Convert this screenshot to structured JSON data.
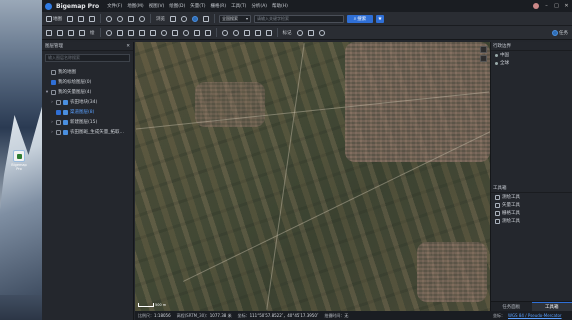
{
  "desktop": {
    "icon_label": "Bigemap\nPro"
  },
  "app": {
    "title": "Bigemap Pro",
    "menu": [
      "文件(F)",
      "地图(M)",
      "视图(V)",
      "绘图(D)",
      "矢量(T)",
      "栅格(R)",
      "工具(T)",
      "分析(A)",
      "帮助(H)"
    ]
  },
  "toolbar1": {
    "map_label": "地图",
    "browse_label": "浏览",
    "search_type": "全国搜索",
    "search_placeholder": "请输入关键字检索",
    "search_button": "搜索",
    "star": "★"
  },
  "toolbar2": {
    "draw_label": "绘绘",
    "draw_sub": "绘",
    "mark_label": "标记",
    "export_label": "导出",
    "task_label": "任务"
  },
  "layers_panel": {
    "title": "图层管理",
    "search_placeholder": "输入图层名称搜索",
    "items": [
      {
        "label": "我的地图",
        "level": 0,
        "checked": false,
        "caret": ""
      },
      {
        "label": "我的标绘图层(0)",
        "level": 0,
        "checked": true,
        "caret": ""
      },
      {
        "label": "我的矢量图层(4)",
        "level": 0,
        "checked": false,
        "caret": "▾"
      },
      {
        "label": "农田地块(34)",
        "level": 1,
        "checked": false,
        "caret": "›",
        "highlight": false
      },
      {
        "label": "渠道图层(8)",
        "level": 1,
        "checked": true,
        "caret": "",
        "highlight": true
      },
      {
        "label": "新建图层(15)",
        "level": 1,
        "checked": false,
        "caret": "›",
        "highlight": false
      },
      {
        "label": "农田图斑_生成矢量_拓取…",
        "level": 1,
        "checked": false,
        "caret": "›",
        "highlight": false
      }
    ]
  },
  "right_panel": {
    "section_title": "行政边界",
    "section_items": [
      "中国",
      "全球"
    ],
    "tools_title": "工具箱",
    "tools": [
      "测绘工具",
      "矢量工具",
      "栅格工具",
      "测绘工具"
    ],
    "tabs": [
      "任务面板",
      "工具箱"
    ],
    "active_tab": 1
  },
  "map": {
    "scale_text": "500 m"
  },
  "statusbar": {
    "scale_label": "比例尺：",
    "scale_value": "1:18056",
    "elev_label": "高程(SRTM_30)：",
    "elev_value": "1077.38 米",
    "coord_label": "坐标：",
    "coord_value": "111°50′57.8522″，40°45′17.3950″",
    "shot_label": "拍摄时间：",
    "shot_value": "无",
    "proj_label": "坐标：",
    "proj_value": "WGS 84 / Pseudo-Mercator"
  },
  "colors": {
    "accent": "#2f6fd6",
    "link": "#5aa0ff"
  }
}
